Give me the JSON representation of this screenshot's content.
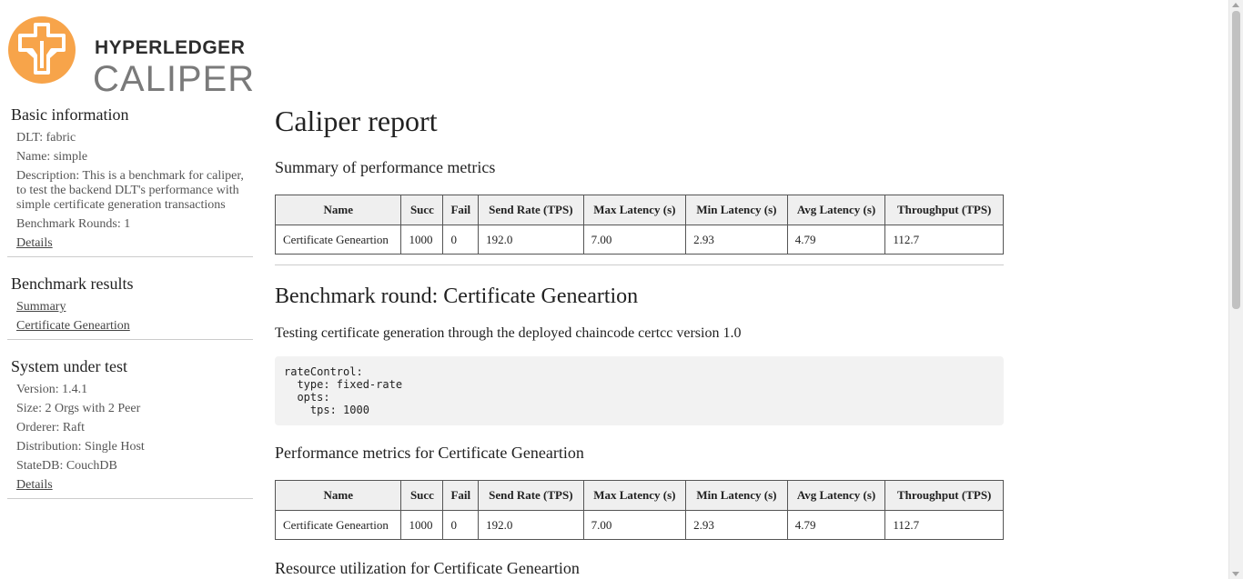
{
  "logo": {
    "line1": "HYPERLEDGER",
    "line2": "CALIPER",
    "color": "#f7a44a"
  },
  "sidebar": {
    "basic": {
      "title": "Basic information",
      "dlt": "DLT:  fabric",
      "name": "Name:  simple",
      "description": "Description:  This is a benchmark for caliper, to test the backend DLT's performance with simple certificate generation transactions",
      "rounds": "Benchmark Rounds:  1",
      "details": "Details"
    },
    "results": {
      "title": "Benchmark results",
      "items": [
        "Summary",
        "Certificate Geneartion"
      ]
    },
    "sut": {
      "title": "System under test",
      "version": "Version:  1.4.1",
      "size": "Size:  2 Orgs with 2 Peer",
      "orderer": "Orderer:  Raft",
      "distribution": "Distribution:  Single Host",
      "statedb": "StateDB:  CouchDB",
      "details": "Details"
    }
  },
  "main": {
    "title": "Caliper report",
    "summary_heading": "Summary of performance metrics",
    "columns": [
      "Name",
      "Succ",
      "Fail",
      "Send Rate (TPS)",
      "Max Latency (s)",
      "Min Latency (s)",
      "Avg Latency (s)",
      "Throughput (TPS)"
    ],
    "summary_row": [
      "Certificate Geneartion",
      "1000",
      "0",
      "192.0",
      "7.00",
      "2.93",
      "4.79",
      "112.7"
    ],
    "round_heading": "Benchmark round: Certificate Geneartion",
    "round_description": "Testing certificate generation through the deployed chaincode certcc version 1.0",
    "config": "rateControl:\n  type: fixed-rate\n  opts:\n    tps: 1000",
    "perf_heading": "Performance metrics for Certificate Geneartion",
    "perf_row": [
      "Certificate Geneartion",
      "1000",
      "0",
      "192.0",
      "7.00",
      "2.93",
      "4.79",
      "112.7"
    ],
    "resource_heading": "Resource utilization for Certificate Geneartion"
  }
}
